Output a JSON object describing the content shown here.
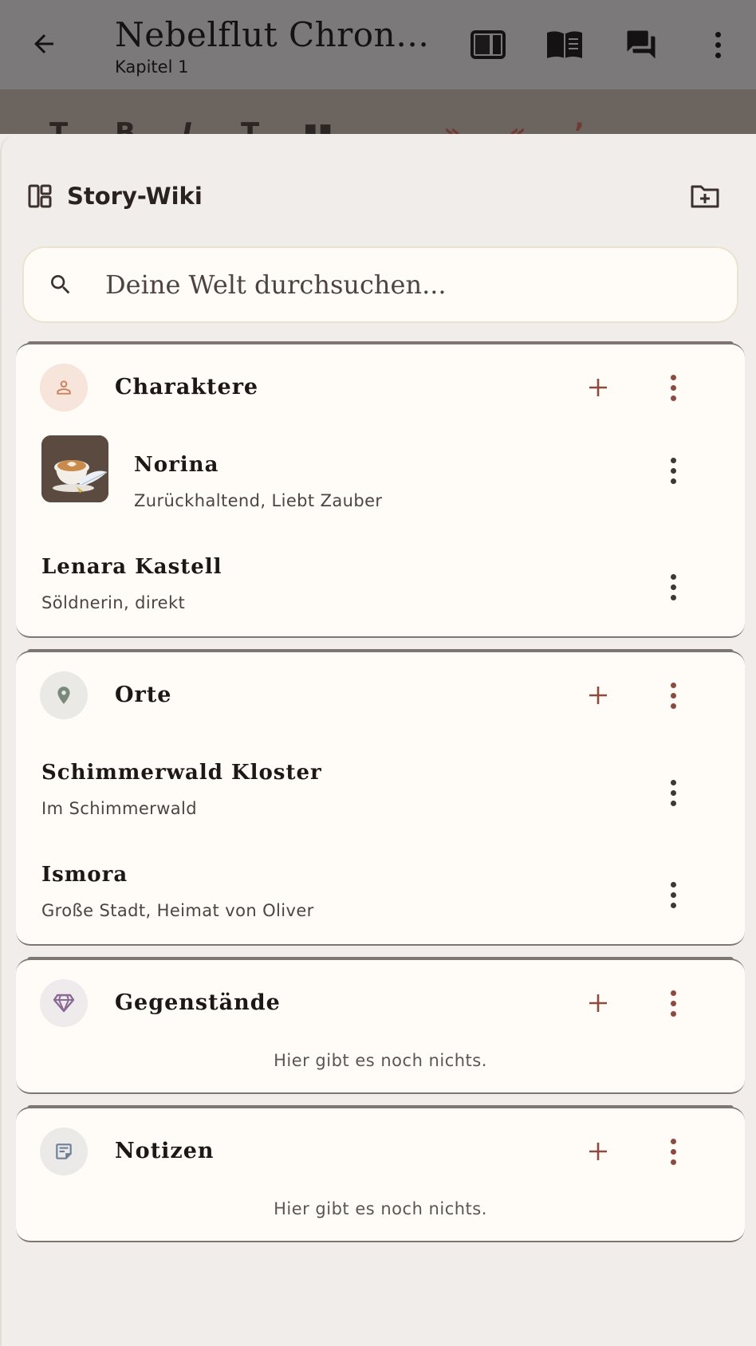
{
  "appbar": {
    "title": "Nebelflut Chroni…",
    "subtitle": "Kapitel 1",
    "actions": [
      "scene-panel-icon",
      "book-icon",
      "chat-icon",
      "more-vert-icon"
    ]
  },
  "toolbar": {
    "items": [
      "T",
      "B",
      "I",
      "T",
      "▮▮",
      "…",
      "»",
      "«",
      "’"
    ]
  },
  "sheet": {
    "title": "Story-Wiki",
    "search_placeholder": "Deine Welt durchsuchen..."
  },
  "sections": [
    {
      "label": "Charaktere",
      "icon": "person-icon",
      "icon_color": "#c9825e",
      "icon_bg": "#f7e4da",
      "entries": [
        {
          "name": "Norina",
          "desc": "Zurückhaltend, Liebt Zauber",
          "has_image": true
        },
        {
          "name": "Lenara Kastell",
          "desc": "Söldnerin, direkt",
          "has_image": false
        }
      ]
    },
    {
      "label": "Orte",
      "icon": "location-pin-icon",
      "icon_color": "#7a8a78",
      "icon_bg": "#eae9e6",
      "entries": [
        {
          "name": "Schimmerwald Kloster",
          "desc": "Im Schimmerwald",
          "has_image": false
        },
        {
          "name": "Ismora",
          "desc": "Große Stadt, Heimat von Oliver",
          "has_image": false
        }
      ]
    },
    {
      "label": "Gegenstände",
      "icon": "gem-icon",
      "icon_color": "#8a6a92",
      "icon_bg": "#efeaec",
      "empty_text": "Hier gibt es noch nichts."
    },
    {
      "label": "Notizen",
      "icon": "note-icon",
      "icon_color": "#6e8096",
      "icon_bg": "#eceae9",
      "empty_text": "Hier gibt es noch nichts."
    }
  ],
  "colors": {
    "accent": "#8f4a3f",
    "dots": "#3e3835",
    "card_bg": "#fffcf8",
    "sheet_bg": "#f1edea"
  }
}
